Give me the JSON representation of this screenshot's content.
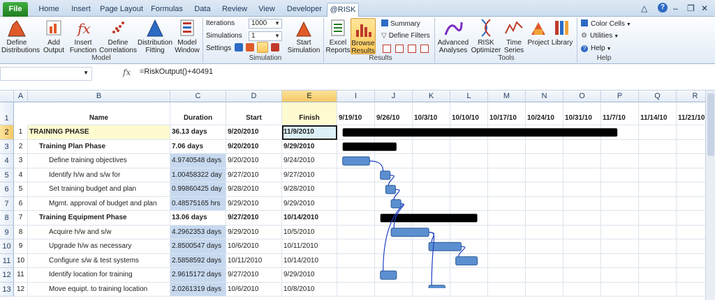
{
  "tabs": [
    {
      "label": "File",
      "x": 0
    },
    {
      "label": "Home"
    },
    {
      "label": "Insert"
    },
    {
      "label": "Page Layout"
    },
    {
      "label": "Formulas"
    },
    {
      "label": "Data"
    },
    {
      "label": "Review"
    },
    {
      "label": "View"
    },
    {
      "label": "Developer"
    },
    {
      "label": "@RISK"
    }
  ],
  "ribbon": {
    "model": {
      "group_label": "Model",
      "define_distributions": "Define\nDistributions",
      "add_output": "Add\nOutput",
      "insert_function": "Insert\nFunction",
      "define_correlations": "Define\nCorrelations",
      "distribution_fitting": "Distribution\nFitting",
      "model_window": "Model\nWindow"
    },
    "simulation": {
      "group_label": "Simulation",
      "iterations_label": "Iterations",
      "iterations_value": "1000",
      "simulations_label": "Simulations",
      "simulations_value": "1",
      "settings_label": "Settings",
      "start_simulation": "Start\nSimulation"
    },
    "results": {
      "group_label": "Results",
      "excel_reports": "Excel\nReports",
      "browse_results": "Browse\nResults",
      "summary": "Summary",
      "define_filters": "Define Filters"
    },
    "tools": {
      "group_label": "Tools",
      "advanced_analyses": "Advanced\nAnalyses",
      "risk_optimizer": "RISK\nOptimizer",
      "time_series": "Time\nSeries",
      "project": "Project",
      "library": "Library"
    },
    "help": {
      "group_label": "Help",
      "color_cells": "Color Cells",
      "utilities": "Utilities",
      "help": "Help"
    }
  },
  "formula_bar": {
    "name_box": "",
    "fx": "fx",
    "formula": "=RiskOutput()+40491"
  },
  "columns": [
    "A",
    "B",
    "C",
    "D",
    "E",
    "I",
    "J",
    "K",
    "L",
    "M",
    "N",
    "O",
    "P",
    "Q",
    "R"
  ],
  "header_row": {
    "row": "1",
    "name": "Name",
    "duration": "Duration",
    "start": "Start",
    "finish": "Finish",
    "dates": [
      "9/19/10",
      "9/26/10",
      "10/3/10",
      "10/10/10",
      "10/17/10",
      "10/24/10",
      "10/31/10",
      "11/7/10",
      "11/14/10",
      "11/21/10"
    ]
  },
  "rows": [
    {
      "row": "2",
      "id": "1",
      "name": "TRAINING PHASE",
      "duration": "36.13 days",
      "start": "9/20/2010",
      "finish": "11/9/2010",
      "level": 0
    },
    {
      "row": "3",
      "id": "2",
      "name": "Training Plan Phase",
      "duration": "7.06 days",
      "start": "9/20/2010",
      "finish": "9/29/2010",
      "level": 1
    },
    {
      "row": "4",
      "id": "3",
      "name": "Define training objectives",
      "duration": "4.9740548 days",
      "start": "9/20/2010",
      "finish": "9/24/2010",
      "level": 2
    },
    {
      "row": "5",
      "id": "4",
      "name": "Identify h/w and s/w for",
      "duration": "1.00458322 day",
      "start": "9/27/2010",
      "finish": "9/27/2010",
      "level": 2
    },
    {
      "row": "6",
      "id": "5",
      "name": "Set training budget and plan",
      "duration": "0.99860425 day",
      "start": "9/28/2010",
      "finish": "9/28/2010",
      "level": 2
    },
    {
      "row": "7",
      "id": "6",
      "name": "Mgmt. approval of budget and plan",
      "duration": "0.48575165 hrs",
      "start": "9/29/2010",
      "finish": "9/29/2010",
      "level": 2
    },
    {
      "row": "8",
      "id": "7",
      "name": "Training Equipment Phase",
      "duration": "13.06 days",
      "start": "9/27/2010",
      "finish": "10/14/2010",
      "level": 1
    },
    {
      "row": "9",
      "id": "8",
      "name": "Acquire h/w and s/w",
      "duration": "4.2962353 days",
      "start": "9/29/2010",
      "finish": "10/5/2010",
      "level": 2
    },
    {
      "row": "10",
      "id": "9",
      "name": "Upgrade h/w as necessary",
      "duration": "2.8500547 days",
      "start": "10/6/2010",
      "finish": "10/11/2010",
      "level": 2
    },
    {
      "row": "11",
      "id": "10",
      "name": "Configure s/w & test systems",
      "duration": "2.5858592 days",
      "start": "10/11/2010",
      "finish": "10/14/2010",
      "level": 2
    },
    {
      "row": "12",
      "id": "11",
      "name": "Identify location for training",
      "duration": "2.9615172 days",
      "start": "9/27/2010",
      "finish": "9/29/2010",
      "level": 2
    },
    {
      "row": "13",
      "id": "12",
      "name": "Move equipt. to training location",
      "duration": "2.0261319 days",
      "start": "10/6/2010",
      "finish": "10/8/2010",
      "level": 2
    }
  ],
  "colors": {
    "summary_bar": "#000000",
    "task_bar": "#5b8fd0",
    "link": "#1f3fc4",
    "selected_header": "#f5c865",
    "training_highlight": "#fffbd0",
    "duration_highlight": "#c7d9ef"
  }
}
